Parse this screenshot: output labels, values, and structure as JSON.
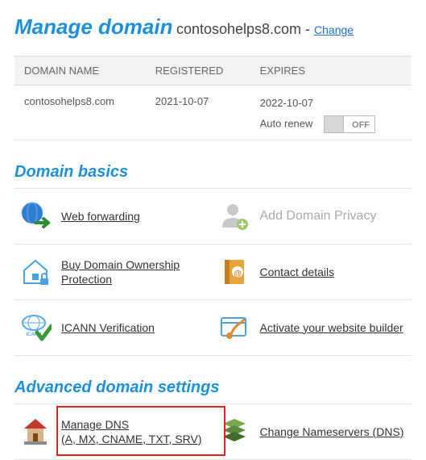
{
  "header": {
    "title": "Manage domain",
    "domain": "contosohelps8.com",
    "separator": " - ",
    "change_label": "Change"
  },
  "table": {
    "headers": {
      "name": "DOMAIN NAME",
      "registered": "REGISTERED",
      "expires": "EXPIRES"
    },
    "row": {
      "name": "contosohelps8.com",
      "registered": "2021-10-07",
      "expires": "2022-10-07",
      "auto_renew_label": "Auto renew",
      "toggle_state": "OFF"
    }
  },
  "sections": {
    "basics": {
      "title": "Domain basics",
      "items": [
        {
          "label": "Web forwarding",
          "enabled": true,
          "icon": "globe-arrow-icon"
        },
        {
          "label": "Add Domain Privacy",
          "enabled": false,
          "icon": "person-plus-icon"
        },
        {
          "label": "Buy Domain Ownership Protection",
          "enabled": true,
          "icon": "house-lock-icon"
        },
        {
          "label": "Contact details",
          "enabled": true,
          "icon": "address-book-icon"
        },
        {
          "label": "ICANN Verification",
          "enabled": true,
          "icon": "icann-check-icon"
        },
        {
          "label": "Activate your website builder",
          "enabled": true,
          "icon": "paintbrush-window-icon"
        }
      ]
    },
    "advanced": {
      "title": "Advanced domain settings",
      "items": [
        {
          "label": "Manage DNS\n(A, MX, CNAME, TXT, SRV)",
          "enabled": true,
          "icon": "dns-house-icon",
          "highlight": true
        },
        {
          "label": "Change Nameservers (DNS)",
          "enabled": true,
          "icon": "server-stack-icon"
        }
      ]
    }
  },
  "colors": {
    "accent": "#1e90d8",
    "highlight": "#e02020"
  }
}
